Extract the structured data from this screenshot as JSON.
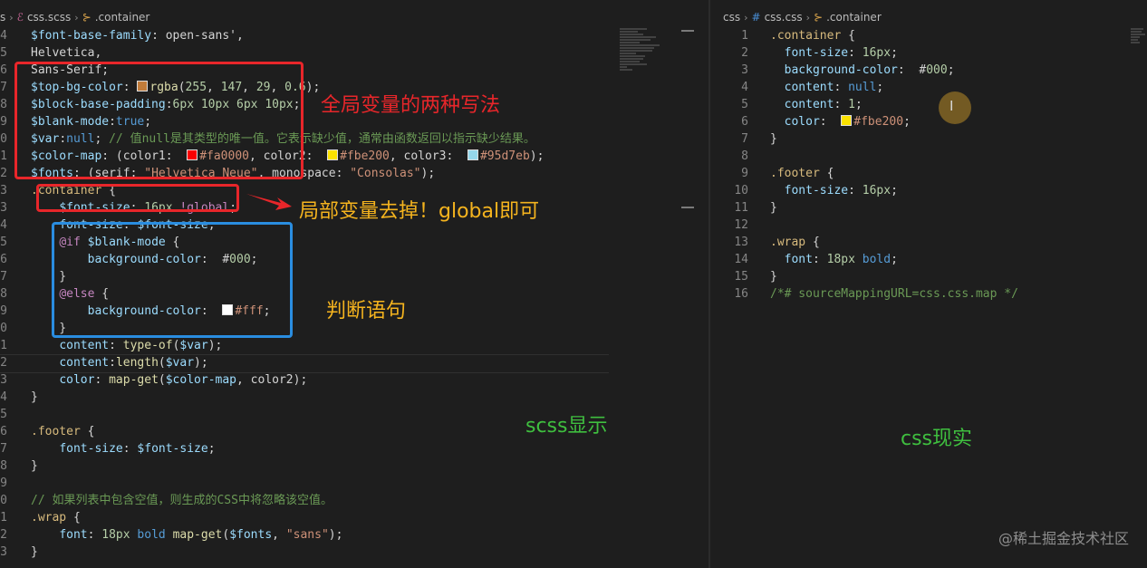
{
  "left_breadcrumb": {
    "seg0": "s",
    "file": "css.scss",
    "symbol": ".container"
  },
  "right_breadcrumb": {
    "folder": "css",
    "file": "css.css",
    "symbol": ".container"
  },
  "left_code": [
    {
      "n": "4",
      "text": "$font-base-family: open-sans',"
    },
    {
      "n": "5",
      "text": "Helvetica,"
    },
    {
      "n": "6",
      "text": "Sans-Serif;"
    },
    {
      "n": "7",
      "text": "$top-bg-color: rgba(255, 147, 29, 0.6);"
    },
    {
      "n": "8",
      "text": "$block-base-padding:6px 10px 6px 10px;"
    },
    {
      "n": "9",
      "text": "$blank-mode:true;"
    },
    {
      "n": "0",
      "text": "$var:null; // 值null是其类型的唯一值。它表示缺少值，通常由函数返回以指示缺少结果。"
    },
    {
      "n": "1",
      "text": "$color-map: (color1:  #fa0000, color2:  #fbe200, color3:  #95d7eb);"
    },
    {
      "n": "2",
      "text": "$fonts: (serif: \"Helvetica Neue\", monospace: \"Consolas\");"
    },
    {
      "n": "3",
      "text": ".container {"
    },
    {
      "n": "3",
      "text": "    $font-size: 16px !global;"
    },
    {
      "n": "4",
      "text": "    font-size: $font-size;"
    },
    {
      "n": "5",
      "text": "    @if $blank-mode {"
    },
    {
      "n": "6",
      "text": "        background-color:  #000;"
    },
    {
      "n": "7",
      "text": "    }"
    },
    {
      "n": "8",
      "text": "    @else {"
    },
    {
      "n": "9",
      "text": "        background-color:  #fff;"
    },
    {
      "n": "0",
      "text": "    }"
    },
    {
      "n": "1",
      "text": "    content: type-of($var);"
    },
    {
      "n": "2",
      "text": "    content:length($var);"
    },
    {
      "n": "3",
      "text": "    color: map-get($color-map, color2);"
    },
    {
      "n": "4",
      "text": "}"
    },
    {
      "n": "5",
      "text": ""
    },
    {
      "n": "6",
      "text": ".footer {"
    },
    {
      "n": "7",
      "text": "    font-size: $font-size;"
    },
    {
      "n": "8",
      "text": "}"
    },
    {
      "n": "9",
      "text": ""
    },
    {
      "n": "0",
      "text": "// 如果列表中包含空值，则生成的CSS中将忽略该空值。"
    },
    {
      "n": "1",
      "text": ".wrap {"
    },
    {
      "n": "2",
      "text": "    font: 18px bold map-get($fonts, \"sans\");"
    },
    {
      "n": "3",
      "text": "}"
    }
  ],
  "right_code": [
    {
      "n": "1",
      "text": ".container {"
    },
    {
      "n": "2",
      "text": "  font-size: 16px;"
    },
    {
      "n": "3",
      "text": "  background-color:  #000;"
    },
    {
      "n": "4",
      "text": "  content: null;"
    },
    {
      "n": "5",
      "text": "  content: 1;"
    },
    {
      "n": "6",
      "text": "  color:  #fbe200;"
    },
    {
      "n": "7",
      "text": "}"
    },
    {
      "n": "8",
      "text": ""
    },
    {
      "n": "9",
      "text": ".footer {"
    },
    {
      "n": "10",
      "text": "  font-size: 16px;"
    },
    {
      "n": "11",
      "text": "}"
    },
    {
      "n": "12",
      "text": ""
    },
    {
      "n": "13",
      "text": ".wrap {"
    },
    {
      "n": "14",
      "text": "  font: 18px bold;"
    },
    {
      "n": "15",
      "text": "}"
    },
    {
      "n": "16",
      "text": "/*# sourceMappingURL=css.css.map */"
    }
  ],
  "annotations": {
    "global_vars": "全局变量的两种写法",
    "local_global": "局部变量去掉！global即可",
    "conditional": "判断语句",
    "scss_label": "scss显示",
    "css_label": "css现实"
  },
  "colors": {
    "red": "#e8262a",
    "blue": "#2a8de0",
    "orange_text": "#f5b41e",
    "green_text": "#3fbf3f",
    "swatch_top_bg": "#c07b3a",
    "swatch_red": "#fa0000",
    "swatch_yellow": "#fbe200",
    "swatch_blue": "#95d7eb",
    "swatch_black": "#000000",
    "swatch_white": "#ffffff"
  },
  "watermark": "@稀土掘金技术社区"
}
